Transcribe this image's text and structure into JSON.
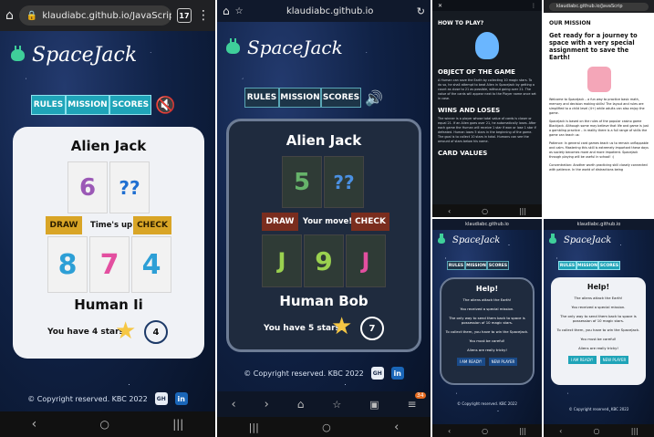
{
  "panel1": {
    "url": "klaudiabc.github.io/JavaScrip",
    "tab_count": "17",
    "logo": "SpaceJack",
    "nav": [
      "RULES",
      "MISSION",
      "SCORES"
    ],
    "alien_name": "Alien Jack",
    "alien_cards": [
      "6",
      "??"
    ],
    "draw": "DRAW",
    "status": "Time's up!",
    "check": "CHECK",
    "human_cards": [
      "8",
      "7",
      "4"
    ],
    "human_name": "Human Ii",
    "stars_text": "You have 4 stars!",
    "stars_count": "4",
    "footer": "© Copyright reserved. KBC 2022",
    "gh": "GH",
    "li": "in"
  },
  "panel2": {
    "url": "klaudiabc.github.io",
    "logo": "SpaceJack",
    "nav": [
      "RULES",
      "MISSION",
      "SCORES"
    ],
    "alien_name": "Alien Jack",
    "alien_cards": [
      "5",
      "??"
    ],
    "draw": "DRAW",
    "status": "Your move!",
    "check": "CHECK",
    "human_cards": [
      "J",
      "9",
      "J"
    ],
    "human_name": "Human Bob",
    "stars_text": "You have 5 stars!",
    "stars_count": "7",
    "footer": "© Copyright reserved. KBC 2022",
    "gh": "GH",
    "li": "in",
    "badge": "34"
  },
  "panel3": {
    "heading": "HOW TO PLAY?",
    "obj_title": "OBJECT OF THE GAME",
    "obj_text": "A Human can save the Earth by collecting 10 magic stars. To do so, he shall attempt to beat Alien in SpaceJack by getting a count as close to 21 as possible, without going over 21. The value of the cards will appear next to the Player name once set in case.",
    "win_title": "WINS AND LOSES",
    "win_text": "The winner is a player whose total value of cards is closer or equal 21. If an Alien goes over 21, he automatically loses. After each game the Human will receive 1 star if won or lose 1 star if defeated. Human loses 5 stars in the beginning of the game. The goal is to collect 10 stars in total. Humans can see the amount of stars below his name.",
    "card_title": "CARD VALUES"
  },
  "panel4": {
    "url": "klaudiabc.github.io/JavaScrip",
    "heading": "OUR MISSION",
    "lead": "Get ready for a journey to space with a very special assignment to save the Earth!",
    "p1": "Welcome to SpaceJack – a fun way to practice basic math, memory and decision making skills! The layout and rules are simplified to a child level (4+) while adults can also enjoy the game.",
    "p2": "SpaceJack is based on the rules of the popular casino game Blackjack. Although some may believe that life and game is just a gambling practice – in reality there is a full range of skills the game can teach us:",
    "p3": "Patience: In general card games teach us to remain unflappable and calm. Mastering this skill is extremely important these days as society becomes more and more impatient. SpaceJack through playing will be useful in school! :)",
    "p4": "Concentration: Another worth practicing skill closely connected with patience. In the world of distractions being"
  },
  "panel5": {
    "url": "klaudiabc.github.io",
    "logo": "SpaceJack",
    "nav": [
      "RULES",
      "MISSION",
      "SCORES"
    ],
    "title": "Help!",
    "lines": [
      "The aliens attack the Earth!",
      "You received a special mission.",
      "The only way to send them back to space is possession of 10 magic stars.",
      "To collect them, you have to win the SpaceJack.",
      "You must be careful!",
      "Aliens are really tricky!"
    ],
    "ready": "I AM READY!",
    "new_player": "NEW PLAYER",
    "footer": "© Copyright reserved. KBC 2022"
  },
  "panel6": {
    "url": "klaudiabc.github.io",
    "logo": "SpaceJack",
    "nav": [
      "RULES",
      "MISSION",
      "SCORES"
    ],
    "title": "Help!",
    "lines": [
      "The aliens attack the Earth!",
      "You received a special mission.",
      "The only way to send them back to space is possession of 10 magic stars.",
      "To collect them, you have to win the SpaceJack.",
      "You must be careful!",
      "Aliens are really tricky!"
    ],
    "ready": "I AM READY!",
    "new_player": "NEW PLAYER",
    "footer": "© Copyright reserved. KBC 2022"
  },
  "colors": {
    "teal": "#1fa4b8",
    "brown": "#c98a1a",
    "navy": "#1d3a68"
  }
}
